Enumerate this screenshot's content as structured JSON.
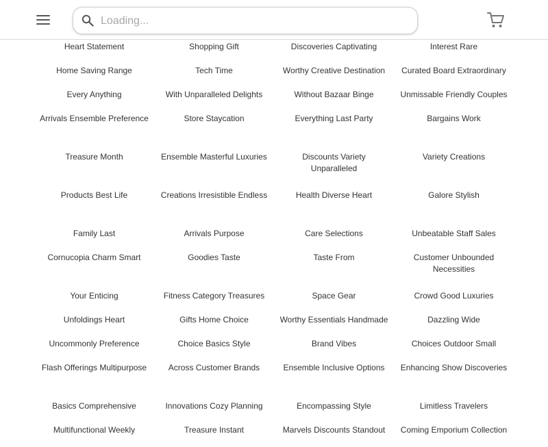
{
  "header": {
    "menu_icon": "hamburger-menu-icon",
    "search": {
      "placeholder": "Loading...",
      "value": "",
      "icon": "search-icon"
    },
    "cart_icon": "shopping-cart-icon"
  },
  "categories": [
    [
      "Heart Statement",
      "Shopping Gift",
      "Discoveries Captivating",
      "Interest Rare"
    ],
    [
      "Home Saving Range",
      "Tech Time",
      "Worthy Creative Destination",
      "Curated Board Extraordinary"
    ],
    [
      "Every Anything",
      "With Unparalleled Delights",
      "Without Bazaar Binge",
      "Unmissable Friendly Couples"
    ],
    [
      "Arrivals Ensemble Preference",
      "Store Staycation",
      "Everything Last Party",
      "Bargains Work"
    ],
    [
      "Treasure Month",
      "Ensemble Masterful Luxuries",
      "Discounts Variety Unparalleled",
      "Variety Creations"
    ],
    [
      "Products Best Life",
      "Creations Irresistible Endless",
      "Health Diverse Heart",
      "Galore Stylish"
    ],
    [
      "Family Last",
      "Arrivals Purpose",
      "Care Selections",
      "Unbeatable Staff Sales"
    ],
    [
      "Cornucopia Charm Smart",
      "Goodies Taste",
      "Taste From",
      "Customer Unbounded Necessities"
    ],
    [
      "Your Enticing",
      "Fitness Category Treasures",
      "Space Gear",
      "Crowd Good Luxuries"
    ],
    [
      "Unfoldings Heart",
      "Gifts Home Choice",
      "Worthy Essentials Handmade",
      "Dazzling Wide"
    ],
    [
      "Uncommonly Preference",
      "Choice Basics Style",
      "Brand Vibes",
      "Choices Outdoor Small"
    ],
    [
      "Flash Offerings Multipurpose",
      "Across Customer Brands",
      "Ensemble Inclusive Options",
      "Enhancing Show Discoveries"
    ],
    [
      "Basics Comprehensive",
      "Innovations Cozy Planning",
      "Encompassing Style",
      "Limitless Travelers"
    ],
    [
      "Multifunctional Weekly",
      "Treasure Instant",
      "Marvels Discounts Standout",
      "Coming Emporium Collection"
    ]
  ]
}
